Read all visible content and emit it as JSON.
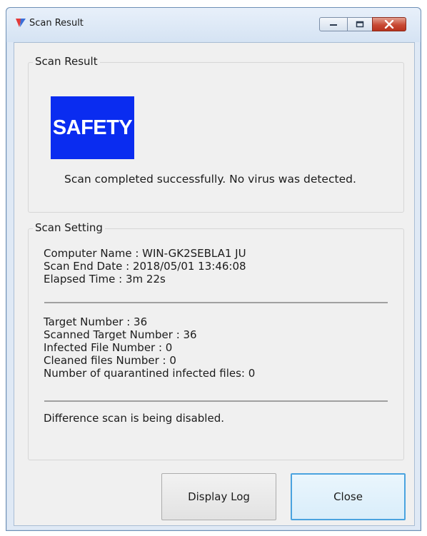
{
  "window": {
    "title": "Scan Result"
  },
  "scan_result": {
    "group_label": "Scan Result",
    "badge_text": "SAFETY",
    "badge_color": "#0a2cf0",
    "message": "Scan completed successfully. No virus was detected."
  },
  "scan_setting": {
    "group_label": "Scan Setting",
    "computer_name": "Computer Name : WIN-GK2SEBLA1 JU",
    "scan_end_date": "Scan End Date : 2018/05/01 13:46:08",
    "elapsed_time": "Elapsed Time :  3m 22s",
    "target_number": "Target Number : 36",
    "scanned_target_number": "Scanned Target Number : 36",
    "infected_file_number": "Infected File Number : 0",
    "cleaned_files_number": "Cleaned files Number : 0",
    "quarantined_files": "Number of quarantined infected files: 0",
    "difference_scan": "Difference scan is being disabled."
  },
  "buttons": {
    "display_log": "Display Log",
    "close": "Close"
  }
}
